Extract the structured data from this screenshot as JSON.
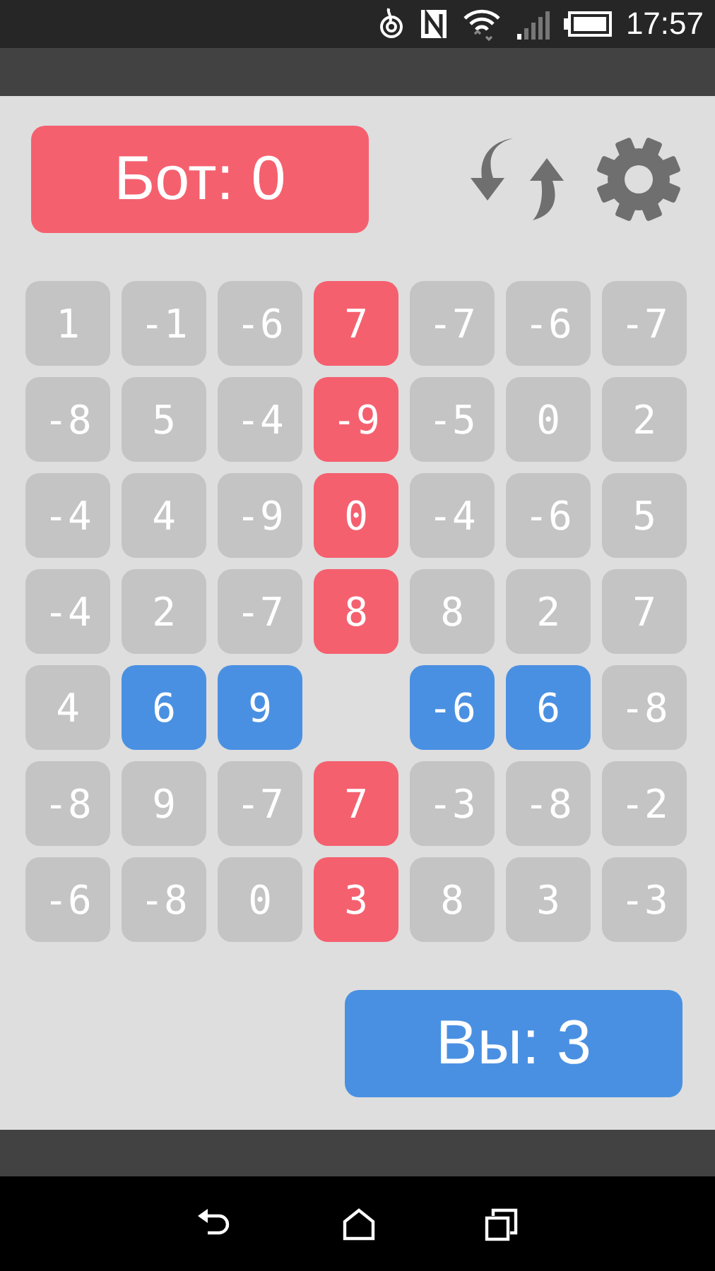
{
  "status_bar": {
    "time": "17:57"
  },
  "bot_score": {
    "label": "Бот: 0"
  },
  "grid": [
    [
      {
        "kind": "free",
        "value": "1"
      },
      {
        "kind": "free",
        "value": "-1"
      },
      {
        "kind": "free",
        "value": "-6"
      },
      {
        "kind": "bot",
        "value": "7"
      },
      {
        "kind": "free",
        "value": "-7"
      },
      {
        "kind": "free",
        "value": "-6"
      },
      {
        "kind": "free",
        "value": "-7"
      }
    ],
    [
      {
        "kind": "free",
        "value": "-8"
      },
      {
        "kind": "free",
        "value": "5"
      },
      {
        "kind": "free",
        "value": "-4"
      },
      {
        "kind": "bot",
        "value": "-9"
      },
      {
        "kind": "free",
        "value": "-5"
      },
      {
        "kind": "free",
        "value": "0"
      },
      {
        "kind": "free",
        "value": "2"
      }
    ],
    [
      {
        "kind": "free",
        "value": "-4"
      },
      {
        "kind": "free",
        "value": "4"
      },
      {
        "kind": "free",
        "value": "-9"
      },
      {
        "kind": "bot",
        "value": "0"
      },
      {
        "kind": "free",
        "value": "-4"
      },
      {
        "kind": "free",
        "value": "-6"
      },
      {
        "kind": "free",
        "value": "5"
      }
    ],
    [
      {
        "kind": "free",
        "value": "-4"
      },
      {
        "kind": "free",
        "value": "2"
      },
      {
        "kind": "free",
        "value": "-7"
      },
      {
        "kind": "bot",
        "value": "8"
      },
      {
        "kind": "free",
        "value": "8"
      },
      {
        "kind": "free",
        "value": "2"
      },
      {
        "kind": "free",
        "value": "7"
      }
    ],
    [
      {
        "kind": "free",
        "value": "4"
      },
      {
        "kind": "player",
        "value": "6"
      },
      {
        "kind": "player",
        "value": "9"
      },
      {
        "kind": "empty"
      },
      {
        "kind": "player",
        "value": "-6"
      },
      {
        "kind": "player",
        "value": "6"
      },
      {
        "kind": "free",
        "value": "-8"
      }
    ],
    [
      {
        "kind": "free",
        "value": "-8"
      },
      {
        "kind": "free",
        "value": "9"
      },
      {
        "kind": "free",
        "value": "-7"
      },
      {
        "kind": "bot",
        "value": "7"
      },
      {
        "kind": "free",
        "value": "-3"
      },
      {
        "kind": "free",
        "value": "-8"
      },
      {
        "kind": "free",
        "value": "-2"
      }
    ],
    [
      {
        "kind": "free",
        "value": "-6"
      },
      {
        "kind": "free",
        "value": "-8"
      },
      {
        "kind": "free",
        "value": "0"
      },
      {
        "kind": "bot",
        "value": "3"
      },
      {
        "kind": "free",
        "value": "8"
      },
      {
        "kind": "free",
        "value": "3"
      },
      {
        "kind": "free",
        "value": "-3"
      }
    ]
  ],
  "player_score": {
    "label": "Вы: 3"
  }
}
